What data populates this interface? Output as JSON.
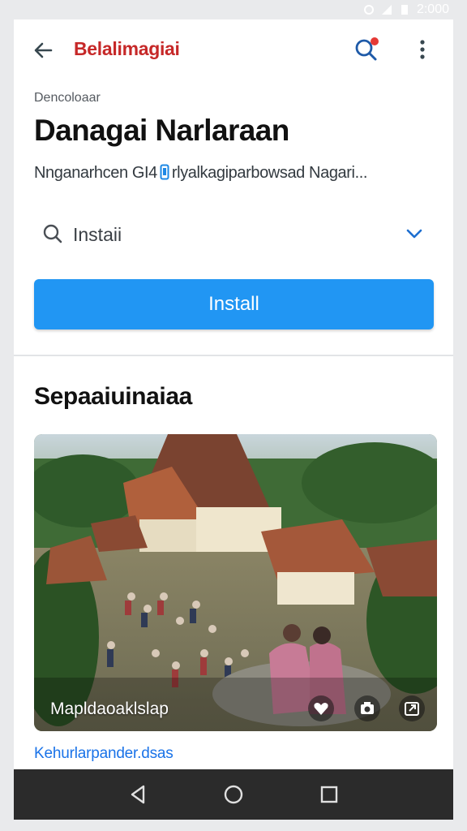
{
  "status_bar": {
    "time": "2:000"
  },
  "app_bar": {
    "brand": "Belalimagiai",
    "icons": [
      "arrow-back-icon",
      "search-icon",
      "more-vert-icon"
    ],
    "brand_color": "#c62828"
  },
  "header": {
    "overline": "Dencoloaar",
    "title": "Danagai Narlaraan",
    "subtitle_pre": "Nnganarhcen GI4",
    "subtitle_post": "rlyalkagiparbowsad Nagari..."
  },
  "selector": {
    "value": "Instaii"
  },
  "install_button": {
    "label": "Install",
    "color": "#2196f3"
  },
  "section": {
    "title": "Sepaaiuinaiaa"
  },
  "photo": {
    "caption": "Mapldaoaklslap",
    "actions": [
      "heart-icon",
      "camera-icon",
      "share-icon"
    ]
  },
  "footer_link": {
    "text": "Kehurlarpander.dsas"
  },
  "nav_bar": {
    "buttons": [
      "back-triangle-icon",
      "home-circle-icon",
      "recents-square-icon"
    ]
  }
}
